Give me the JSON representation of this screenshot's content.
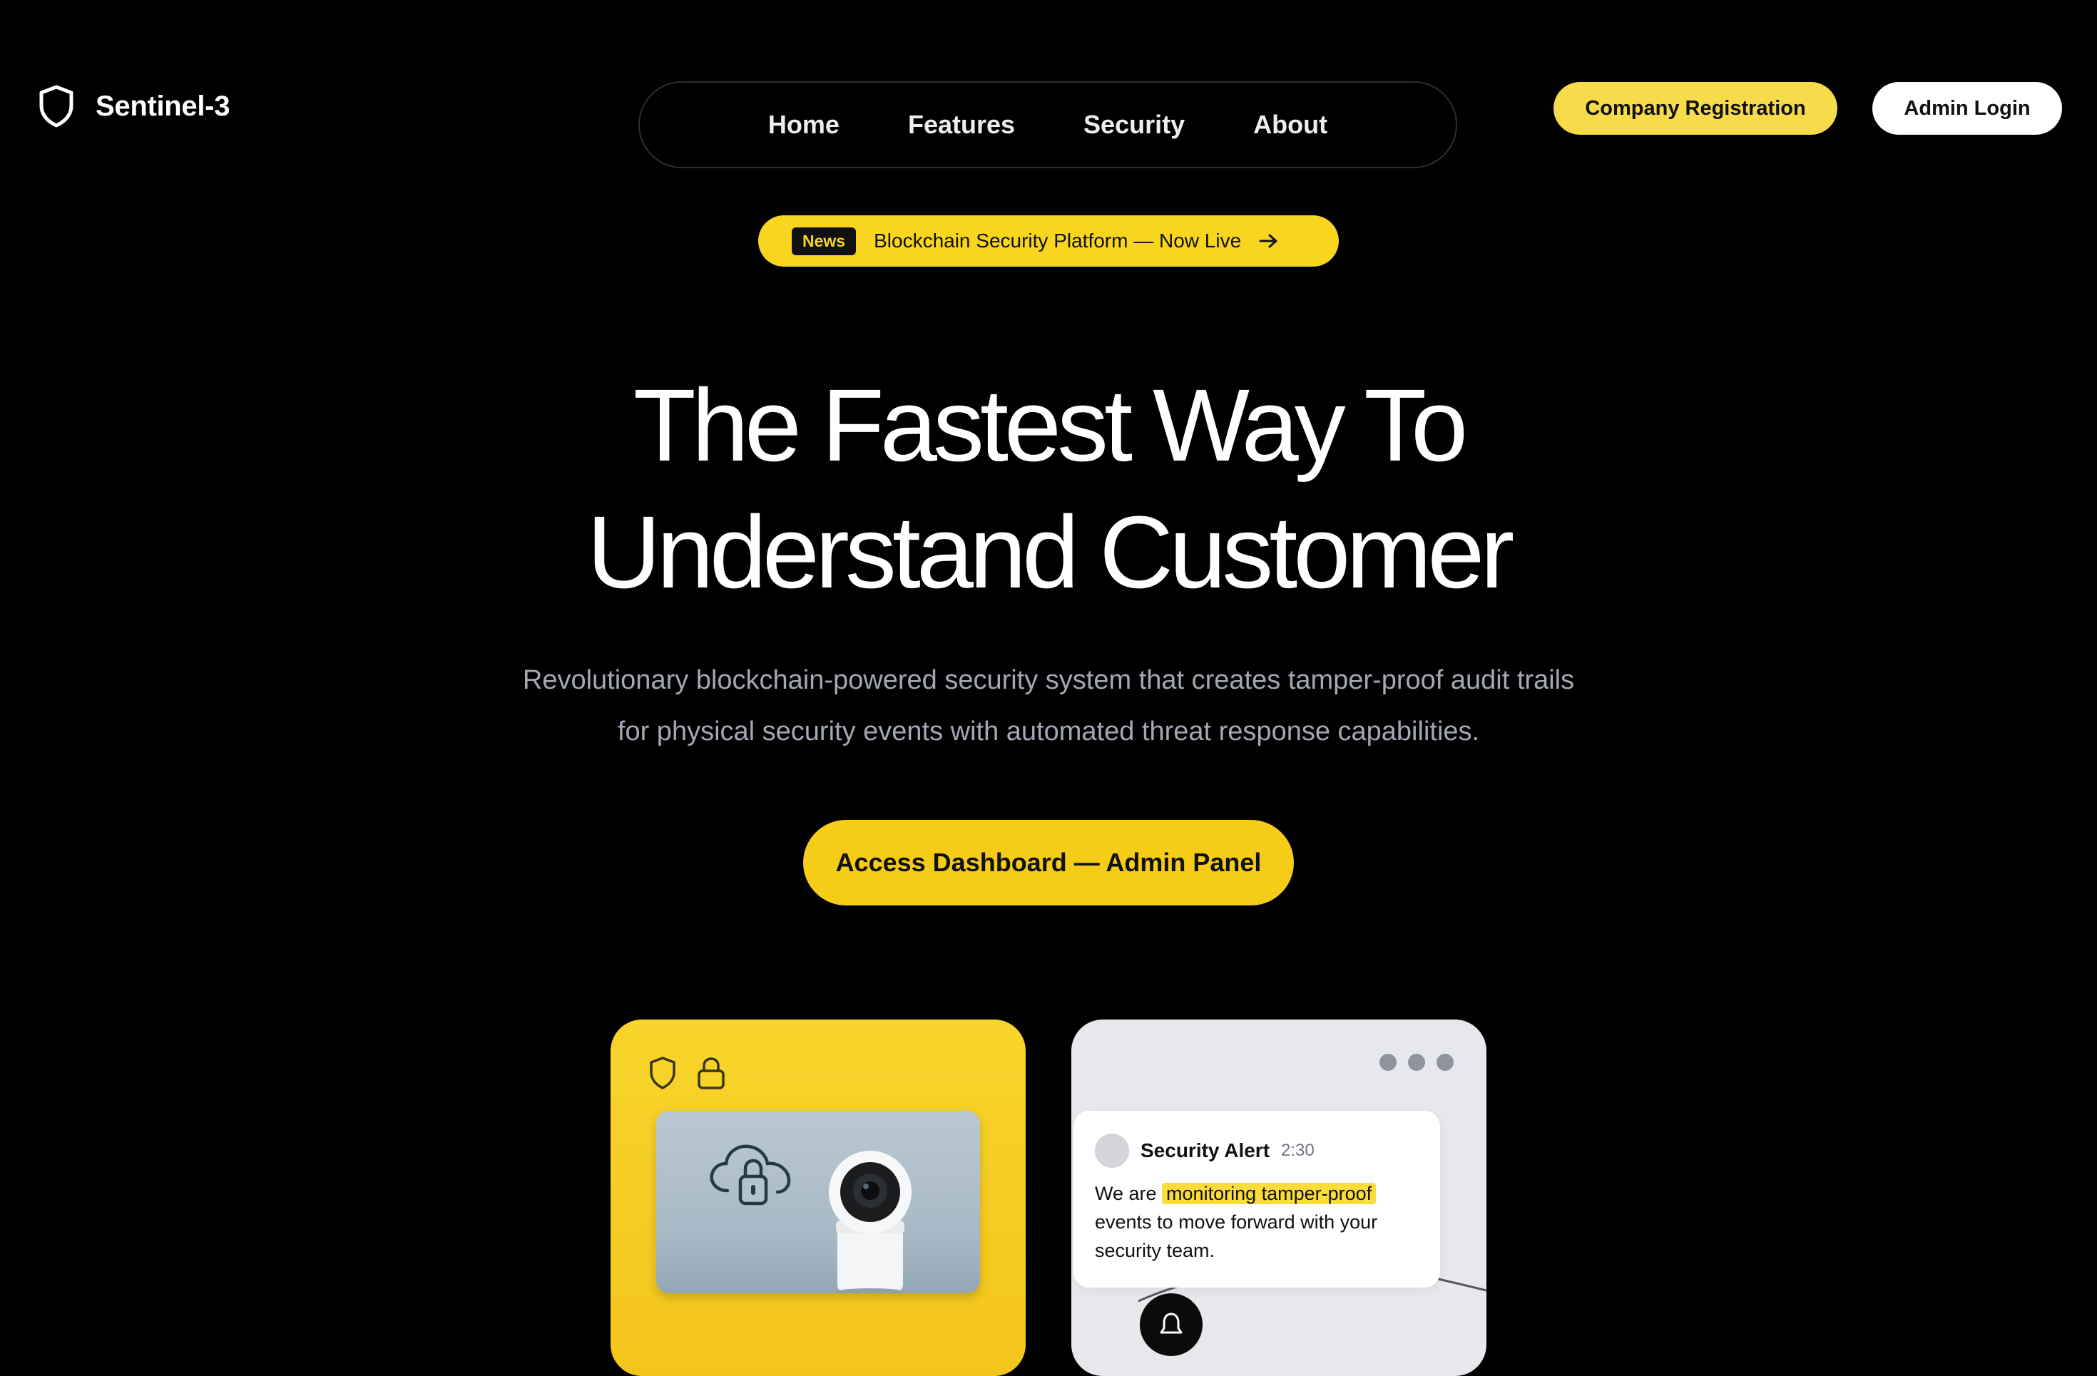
{
  "brand": {
    "name": "Sentinel-3",
    "icon": "shield-icon"
  },
  "nav": {
    "items": [
      "Home",
      "Features",
      "Security",
      "About"
    ]
  },
  "header": {
    "register_label": "Company Registration",
    "login_label": "Admin Login"
  },
  "news": {
    "badge": "News",
    "text": "Blockchain Security Platform — Now Live",
    "icon": "arrow-right-icon"
  },
  "hero": {
    "title_lines": [
      "The Fastest Way To",
      "Understand Customer"
    ],
    "subtitle_lines": [
      "Revolutionary blockchain-powered security system that creates tamper-proof audit trails",
      "for physical security events with automated threat response capabilities."
    ],
    "cta_label": "Access Dashboard — Admin Panel"
  },
  "cards": {
    "camera": {
      "icons": [
        "shield-icon",
        "lock-icon",
        "cloud-lock-icon",
        "security-camera-icon"
      ]
    },
    "alert": {
      "title": "Security Alert",
      "time": "2:30",
      "body_before": "We are ",
      "body_highlight": "monitoring tamper-proof",
      "body_after": " events to move forward with your security team.",
      "icon": "bell-icon"
    }
  },
  "colors": {
    "background": "#000000",
    "accent_yellow": "#f5cc17",
    "register_yellow": "#f7db4a",
    "card_grey": "#e7e8ec",
    "subtitle_grey": "#a3a8b4"
  }
}
